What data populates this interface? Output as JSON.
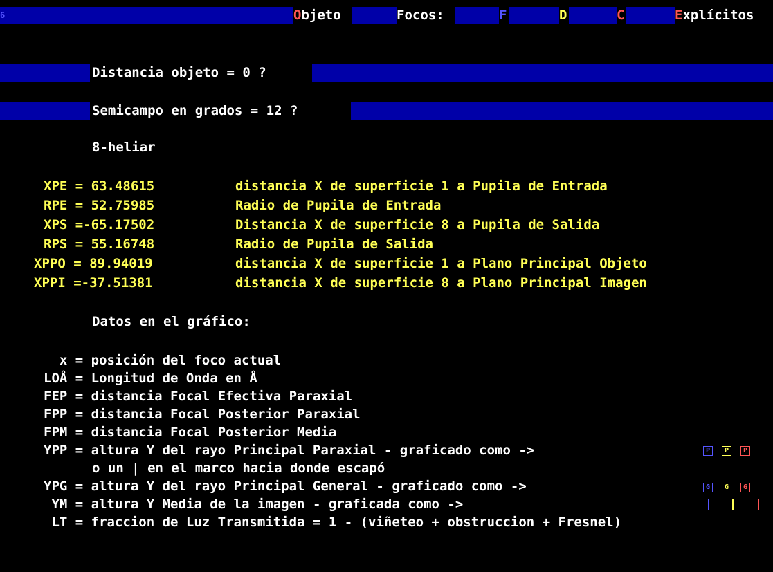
{
  "menu": {
    "corner_mark": "6",
    "objeto_hotkey": "O",
    "objeto_rest": "bjeto",
    "focos_label": "Focos:",
    "foco_f": "F",
    "foco_d": "D",
    "foco_c": "C",
    "explicitos_hotkey": "E",
    "explicitos_rest": "xplícitos"
  },
  "prompts": {
    "distancia": "Distancia objeto = 0 ?",
    "semicampo": "Semicampo en grados = 12 ?"
  },
  "system_name": "8-heliar",
  "results": [
    {
      "label": "XPE = 63.48615",
      "desc": "distancia X de superficie 1 a Pupila de Entrada"
    },
    {
      "label": "RPE = 52.75985",
      "desc": "Radio de Pupila de Entrada"
    },
    {
      "label": "XPS =-65.17502",
      "desc": "Distancia X de superficie 8 a Pupila de Salida"
    },
    {
      "label": "RPS = 55.16748",
      "desc": "Radio de Pupila de Salida"
    },
    {
      "label": "XPPO = 89.94019",
      "desc": "distancia X de superficie 1 a Plano Principal Objeto"
    },
    {
      "label": "XPPI =-37.51381",
      "desc": "distancia X de superficie 8 a Plano Principal Imagen"
    }
  ],
  "legend_title": "Datos en el gráfico:",
  "legend": [
    "x = posición del foco actual",
    "LOÅ = Longitud de Onda en Å",
    "FEP = distancia Focal Efectiva Paraxial",
    "FPP = distancia Focal Posterior Paraxial",
    "FPM = distancia Focal Posterior Media",
    "YPP = altura Y del rayo Principal Paraxial - graficado como ->",
    "o un | en el marco hacia donde escapó",
    "YPG = altura Y del rayo Principal General - graficado como ->",
    "YM = altura Y Media de la imagen - graficada como ->",
    "LT = fraccion de Luz Transmitida = 1 - (viñeteo + obstruccion + Fresnel)"
  ],
  "symbols": {
    "p_letter": "P",
    "g_letter": "G",
    "colors": [
      "#5555ff",
      "#ffff55",
      "#ff5555"
    ]
  }
}
